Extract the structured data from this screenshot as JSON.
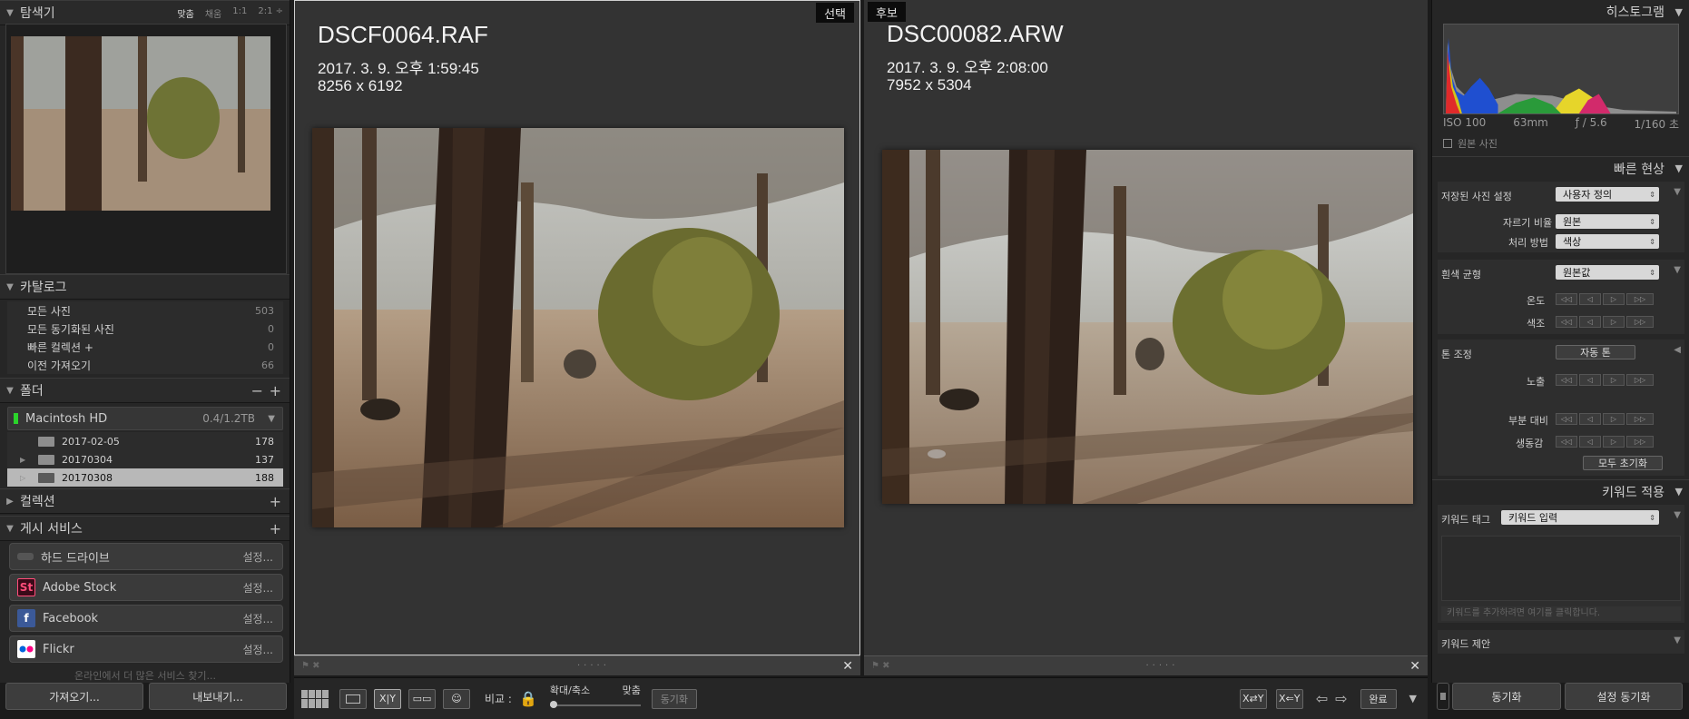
{
  "left": {
    "navigator": {
      "title": "탐색기",
      "options": [
        "맞춤",
        "채움",
        "1:1",
        "2:1 ÷"
      ]
    },
    "catalog": {
      "title": "카탈로그",
      "items": [
        {
          "label": "모든 사진",
          "count": "503"
        },
        {
          "label": "모든 동기화된 사진",
          "count": "0"
        },
        {
          "label": "빠른 컬렉션 +",
          "count": "0"
        },
        {
          "label": "이전 가져오기",
          "count": "66"
        }
      ]
    },
    "folders": {
      "title": "폴더",
      "volume": {
        "name": "Macintosh HD",
        "capacity": "0.4/1.2TB"
      },
      "items": [
        {
          "name": "2017-02-05",
          "count": "178"
        },
        {
          "name": "20170304",
          "count": "137"
        },
        {
          "name": "20170308",
          "count": "188"
        }
      ]
    },
    "collections": {
      "title": "컬렉션"
    },
    "publish": {
      "title": "게시 서비스",
      "services": [
        {
          "name": "하드 드라이브",
          "action": "설정...",
          "icon": "hard-drive-icon"
        },
        {
          "name": "Adobe Stock",
          "action": "설정...",
          "icon": "St"
        },
        {
          "name": "Facebook",
          "action": "설정...",
          "icon": "f"
        },
        {
          "name": "Flickr",
          "action": "설정...",
          "icon": "flickr-icon"
        }
      ],
      "more": "온라인에서 더 많은 서비스 찾기..."
    },
    "import_label": "가져오기...",
    "export_label": "내보내기..."
  },
  "compare": {
    "select": {
      "tag": "선택",
      "filename": "DSCF0064.RAF",
      "date": "2017. 3. 9. 오후 1:59:45",
      "dims": "8256 x 6192"
    },
    "candidate": {
      "tag": "후보",
      "filename": "DSC00082.ARW",
      "date": "2017. 3. 9. 오후 2:08:00",
      "dims": "7952 x 5304"
    }
  },
  "toolbar": {
    "compare_label": "비교 :",
    "zoom_label": "확대/축소",
    "fit_label": "맞춤",
    "sync_label": "동기화",
    "done_label": "완료"
  },
  "right": {
    "histogram": {
      "title": "히스토그램",
      "iso": "ISO 100",
      "focal": "63mm",
      "aperture": "ƒ / 5.6",
      "shutter": "1/160 초",
      "original": "원본 사진"
    },
    "quick_develop": {
      "title": "빠른 현상",
      "preset_label": "저장된 사진 설정",
      "preset_value": "사용자 정의",
      "crop_label": "자르기 비율",
      "crop_value": "원본",
      "treatment_label": "처리 방법",
      "treatment_value": "색상",
      "wb_label": "흰색 균형",
      "wb_value": "원본값",
      "temp_label": "온도",
      "tint_label": "색조",
      "tone_label": "톤 조정",
      "auto_tone": "자동 톤",
      "exposure_label": "노출",
      "clarity_label": "부분 대비",
      "vibrance_label": "생동감",
      "reset_all": "모두 초기화"
    },
    "keywording": {
      "title": "키워드 적용",
      "tag_label": "키워드 태그",
      "tag_value": "키워드 입력",
      "placeholder": "키워드를 추가하려면 여기를 클릭합니다.",
      "suggest_label": "키워드 제안"
    },
    "sync_label": "동기화",
    "sync_settings_label": "설정 동기화"
  }
}
